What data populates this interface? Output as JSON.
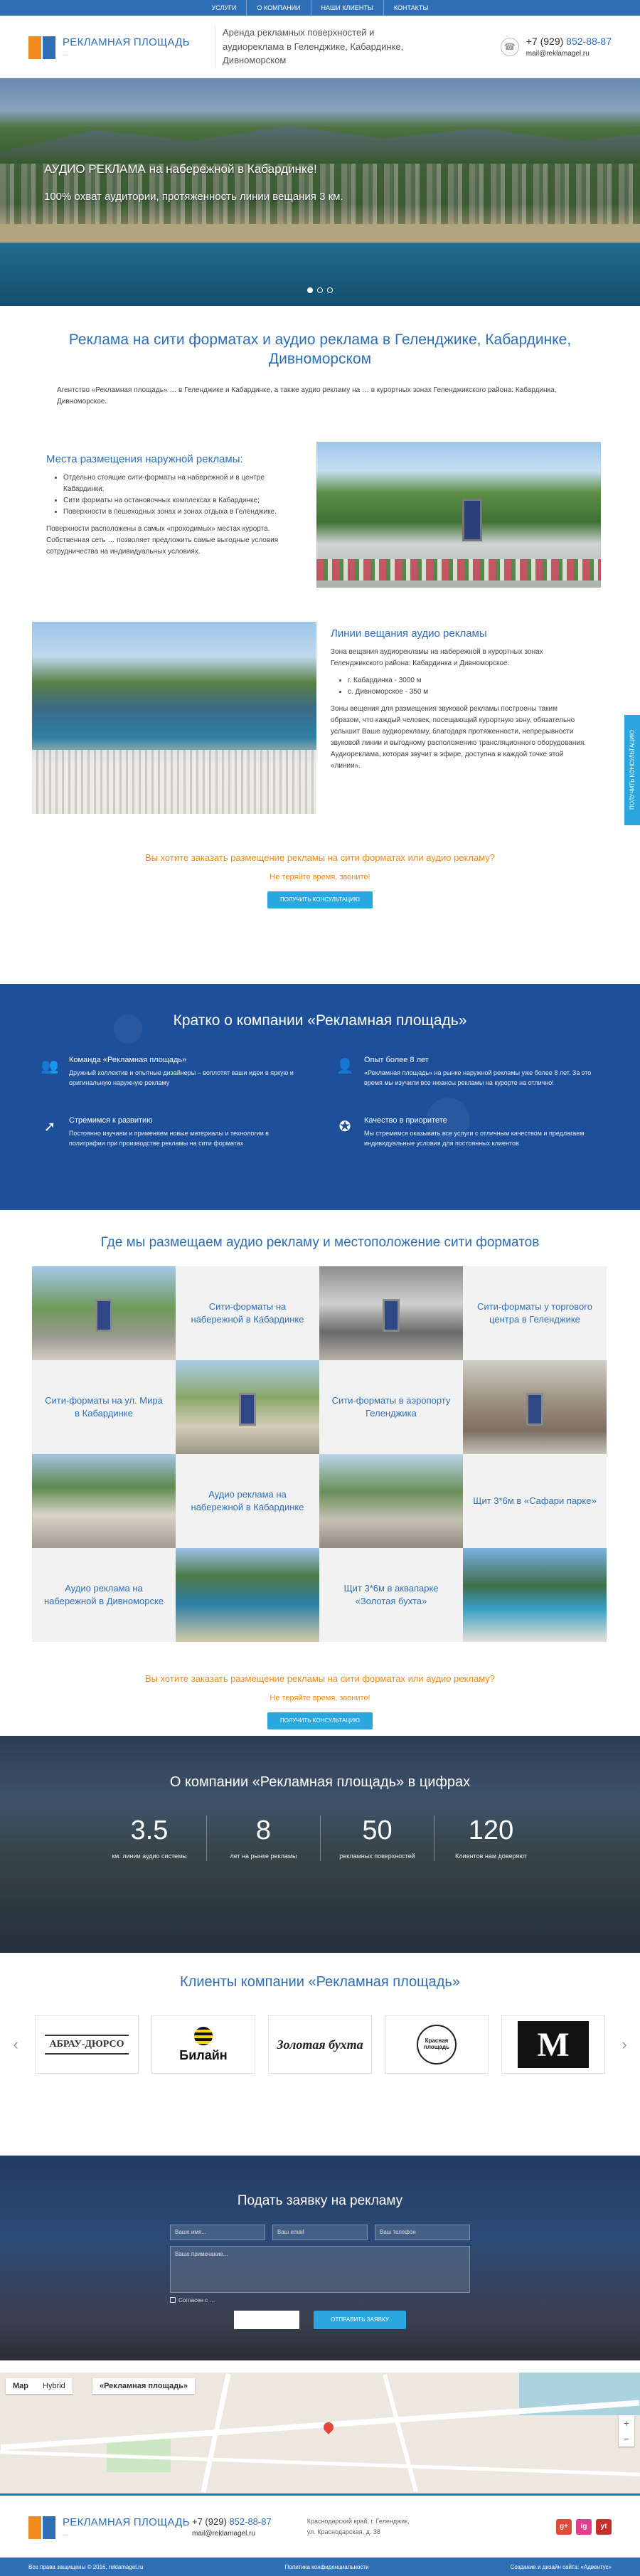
{
  "topnav": [
    "Услуги",
    "О компании",
    "Наши клиенты",
    "Контакты"
  ],
  "brand": {
    "name": "РЕКЛАМНАЯ ПЛОЩАДЬ",
    "tagline": "…"
  },
  "header": {
    "description": "Аренда рекламных поверхностей и аудиореклама в Геленджике, Кабардинке, Дивноморском",
    "phone_prefix": "+7 (929)",
    "phone_number": "852-88-87",
    "email": "mail@reklamagel.ru"
  },
  "hero": {
    "line1": "АУДИО РЕКЛАМА на набережной в Кабардинке!",
    "line2": "100% охват аудитории, протяженность линии вещания 3 км."
  },
  "intro": {
    "title": "Реклама на сити форматах и аудио реклама в Геленджике, Кабардинке, Дивноморском",
    "text": "Агентство «Рекламная площадь» … в Геленджике и Кабардинке, а также аудио рекламу на … в курортных зонах Геленджикского района: Кабардинка, Дивноморское."
  },
  "outdoor": {
    "title": "Места размещения наружной рекламы:",
    "items": [
      "Отдельно стоящие сити-форматы на набережной и в центре Кабардинки;",
      "Сити форматы на остановочных комплексах в Кабардинке;",
      "Поверхности в пешеходных зонах и зонах отдыха в Геленджике."
    ],
    "p": "Поверхности расположены в самых «проходимых» местах курорта. Собственная сеть … позволяет предложить самые выгодные условия сотрудничества на индивидуальных условиях."
  },
  "audio": {
    "title": "Линии вещания аудио рекламы",
    "intro": "Зона вещания аудиорекламы на набережной в курортных зонах Геленджикского района: Кабардинка и Дивноморское.",
    "items": [
      "г. Кабардинка - 3000 м",
      "с. Дивноморское - 350 м"
    ],
    "p": "Зоны вещения для размещения звуковой рекламы построены таким образом, что каждый человек, посещающий курортную зону, обязательно услышит Ваше аудиорекламу, благодаря протяженности, непрерывности звуковой линии и выгодному расположению трансляционного оборудования. Аудиореклама, которая звучит в эфире, доступна в каждой точке этой «линии»."
  },
  "cta": {
    "question": "Вы хотите заказать размещение рекламы на сити форматах или аудио рекламу?",
    "note": "Не теряйте время, звоните!",
    "button": "Получить консультацию"
  },
  "side_tab": "Получить консультацию",
  "about": {
    "title": "Кратко о компании «Рекламная площадь»",
    "items": [
      {
        "icon": "team-icon",
        "title": "Команда «Рекламная площадь»",
        "text": "Дружный коллектив и опытные дизайнеры – воплотят ваши идеи в яркую и оригинальную наружную рекламу"
      },
      {
        "icon": "experience-icon",
        "title": "Опыт более 8 лет",
        "text": "«Рекламная площадь» на рынке наружной рекламы уже более 8 лет. За это время мы изучили все нюансы рекламы на курорте на отлично!"
      },
      {
        "icon": "rocket-icon",
        "title": "Стремимся к развитию",
        "text": "Постоянно изучаем и применяем новые материалы и технологии в полиграфии при производстве рекламы на сити форматах"
      },
      {
        "icon": "quality-icon",
        "title": "Качество в приоритете",
        "text": "Мы стремимся оказывать все услуги с отличным качеством и предлагаем индивидуальные условия для постоянных клиентов"
      }
    ]
  },
  "where": {
    "title": "Где мы размещаем аудио рекламу и местоположение сити форматов",
    "labels": [
      "Сити-форматы на набережной в Кабардинке",
      "Сити-форматы у торгового центра в Геленджике",
      "Сити-форматы на ул. Мира в Кабардинке",
      "Сити-форматы в аэропорту Геленджика",
      "Аудио реклама на набережной в Кабардинке",
      "Щит 3*6м в «Сафари парке»",
      "Аудио реклама на набережной в Дивноморске",
      "Щит 3*6м в аквапарке «Золотая бухта»"
    ]
  },
  "stats": {
    "title": "О компании «Рекламная площадь» в цифрах",
    "items": [
      {
        "value": "3.5",
        "label": "км. линии аудио системы"
      },
      {
        "value": "8",
        "label": "лет на рынке рекламы"
      },
      {
        "value": "50",
        "label": "рекламных поверхностей"
      },
      {
        "value": "120",
        "label": "Клиентов нам доверяют"
      }
    ]
  },
  "clients": {
    "title": "Клиенты компании «Рекламная площадь»",
    "logos": [
      "АБРАУ-ДЮРСО",
      "Билайн",
      "Золотая бухта",
      "Красная площадь",
      "M"
    ]
  },
  "form": {
    "title": "Подать заявку на рекламу",
    "name": "Ваше имя...",
    "email": "Ваш email",
    "phone": "Ваш телефон",
    "comment": "Ваше примечание...",
    "agree": "Согласен с …",
    "submit": "Отправить заявку"
  },
  "map": {
    "tab_map": "Map",
    "tab_hybrid": "Hybrid",
    "label": "«Рекламная площадь»"
  },
  "footer": {
    "phone_prefix": "+7 (929)",
    "phone_number": "852-88-87",
    "email": "mail@reklamagel.ru",
    "address1": "Краснодарский край, г. Геленджик,",
    "address2": "ул. Краснодарская, д. 38",
    "social": [
      "g+",
      "ig",
      "yt"
    ]
  },
  "bottombar": {
    "copyright": "Все права защищены © 2016, reklamagel.ru",
    "privacy": "Политика конфиденциальности",
    "dev": "Создание и дизайн сайта: «Адвентус»"
  }
}
